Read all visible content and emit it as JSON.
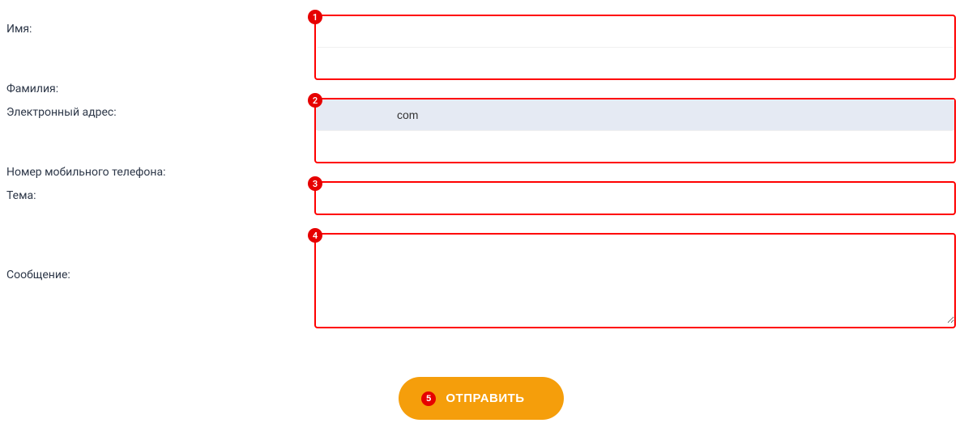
{
  "form": {
    "labels": {
      "name": "Имя:",
      "surname": "Фамилия:",
      "email": "Электронный адрес:",
      "phone": "Номер мобильного телефона:",
      "subject": "Тема:",
      "message": "Сообщение:"
    },
    "values": {
      "name": "",
      "surname": "",
      "email": "com",
      "phone": "",
      "subject": "",
      "message": ""
    },
    "badges": {
      "group1": "1",
      "group2": "2",
      "group3": "3",
      "group4": "4",
      "submit": "5"
    },
    "submit_label": "ОТПРАВИТЬ"
  }
}
